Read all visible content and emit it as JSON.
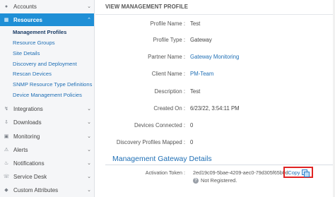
{
  "sidebar": {
    "accounts": {
      "label": "Accounts",
      "icon": "user-icon"
    },
    "resources": {
      "label": "Resources",
      "icon": "grid-icon"
    },
    "sub_items": [
      "Management Profiles",
      "Resource Groups",
      "Site Details",
      "Discovery and Deployment",
      "Rescan Devices",
      "SNMP Resource Type Definitions",
      "Device Management Policies"
    ],
    "sections": [
      {
        "label": "Integrations",
        "icon": "plug-icon"
      },
      {
        "label": "Downloads",
        "icon": "download-icon"
      },
      {
        "label": "Monitoring",
        "icon": "monitor-icon"
      },
      {
        "label": "Alerts",
        "icon": "alert-icon"
      },
      {
        "label": "Notifications",
        "icon": "bell-icon"
      },
      {
        "label": "Service Desk",
        "icon": "headset-icon"
      },
      {
        "label": "Custom Attributes",
        "icon": "tag-icon"
      }
    ]
  },
  "main": {
    "title": "VIEW MANAGEMENT PROFILE",
    "fields": [
      {
        "label": "Profile Name :",
        "value": "Test"
      },
      {
        "label": "Profile Type :",
        "value": "Gateway"
      },
      {
        "label": "Partner Name :",
        "value": "Gateway Monitoring"
      },
      {
        "label": "Client Name :",
        "value": "PM-Team"
      },
      {
        "label": "Description :",
        "value": "Test"
      },
      {
        "label": "Created On :",
        "value": "6/23/22, 3:54:11 PM"
      },
      {
        "label": "Devices Connected :",
        "value": "0"
      },
      {
        "label": "Discovery Profiles Mapped :",
        "value": "0"
      }
    ],
    "section_title": "Management Gateway Details",
    "token": {
      "label": "Activation Token :",
      "value": "2ed19c09-5bae-4209-aec0-79d305f65b0d",
      "copy_label": "Copy"
    },
    "status": "Not Registered."
  },
  "colors": {
    "accent": "#1f8fd6",
    "link": "#1f6fb5",
    "highlight": "#e02424"
  }
}
